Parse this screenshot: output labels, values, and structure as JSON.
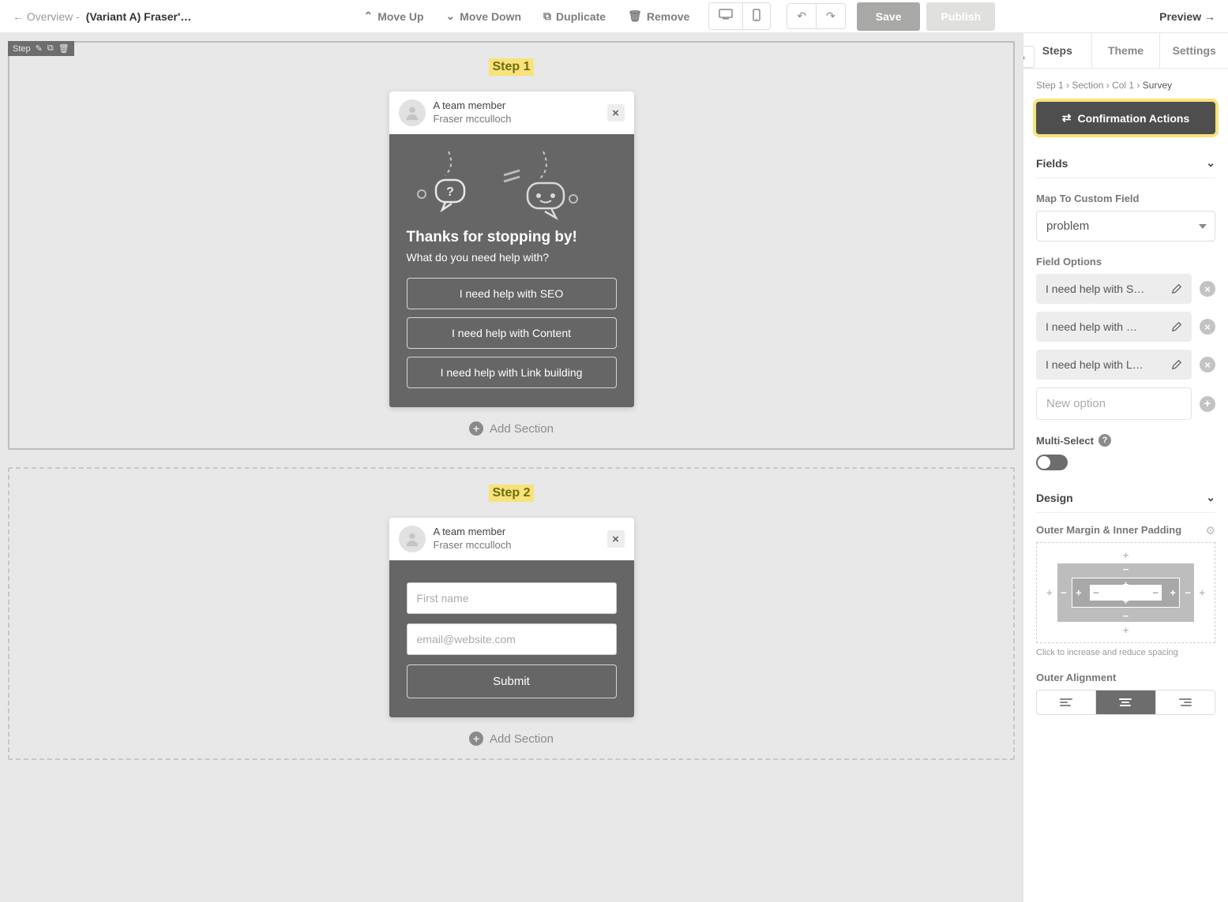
{
  "topbar": {
    "back": "← Overview -",
    "title": "(Variant A) Fraser'…",
    "moveUp": "Move Up",
    "moveDown": "Move Down",
    "duplicate": "Duplicate",
    "remove": "Remove",
    "save": "Save",
    "publish": "Publish",
    "preview": "Preview →"
  },
  "canvas": {
    "stepToolbarLabel": "Step",
    "step1": {
      "title": "Step 1",
      "member": "A team member",
      "author": "Fraser mcculloch",
      "heroTitle": "Thanks for stopping by!",
      "heroSub": "What do you need help with?",
      "opts": [
        "I need help with SEO",
        "I need help with Content",
        "I need help with Link building"
      ],
      "addSection": "Add Section"
    },
    "step2": {
      "title": "Step 2",
      "member": "A team member",
      "author": "Fraser mcculloch",
      "firstNamePh": "First name",
      "emailPh": "email@website.com",
      "submit": "Submit",
      "addSection": "Add Section"
    }
  },
  "panel": {
    "tabs": {
      "steps": "Steps",
      "theme": "Theme",
      "settings": "Settings"
    },
    "breadcrumb": {
      "a": "Step 1",
      "b": "Section",
      "c": "Col 1",
      "d": "Survey"
    },
    "confirmation": "Confirmation Actions",
    "fieldsHeader": "Fields",
    "mapLabel": "Map To Custom Field",
    "mapValue": "problem",
    "fieldOptionsLabel": "Field Options",
    "fieldOptions": [
      "I need help with S…",
      "I need help with …",
      "I need help with L…"
    ],
    "newOption": "New option",
    "multiSelect": "Multi-Select",
    "designHeader": "Design",
    "spacingLabel": "Outer Margin & Inner Padding",
    "spacingHint": "Click to increase and reduce spacing",
    "alignLabel": "Outer Alignment"
  }
}
